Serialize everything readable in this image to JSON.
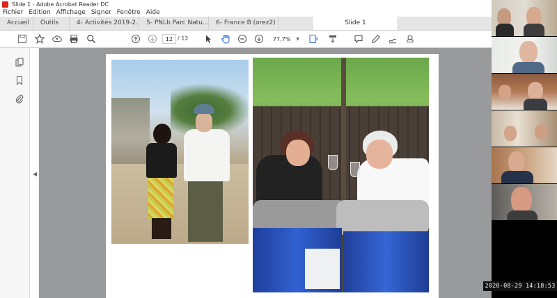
{
  "window": {
    "title": "Slide 1 - Adobe Acrobat Reader DC"
  },
  "menu": [
    "Fichier",
    "Edition",
    "Affichage",
    "Signer",
    "Fenêtre",
    "Aide"
  ],
  "tabs": {
    "home": "Accueil",
    "tools": "Outils",
    "docs": [
      "4- Activités 2019-2...",
      "5- PNLb Parc Natu...",
      "6- France B (orez2) ..."
    ],
    "active": "Slide 1"
  },
  "toolbar": {
    "page_current": "12",
    "page_total": "/ 12",
    "zoom": "77,7%"
  },
  "recording": {
    "timestamp": "2020-08-29 14:18:53"
  },
  "colors": {
    "acrobat_red": "#d8261c",
    "canvas_gray": "#999a9c",
    "tab_bg": "#e5e5e5",
    "barrel_blue": "#3161d1"
  },
  "icons": {
    "save": "save-icon",
    "bookmark": "star-icon",
    "upload": "cloud-upload-icon",
    "print": "print-icon",
    "search": "search-icon",
    "prev": "page-up-icon",
    "next": "page-down-icon",
    "select": "cursor-icon",
    "hand": "hand-icon",
    "zoom_out": "zoom-out-icon",
    "zoom_in": "zoom-in-icon",
    "comment": "comment-icon",
    "highlight": "pen-icon",
    "sign": "sign-icon",
    "stamp": "stamp-icon"
  }
}
